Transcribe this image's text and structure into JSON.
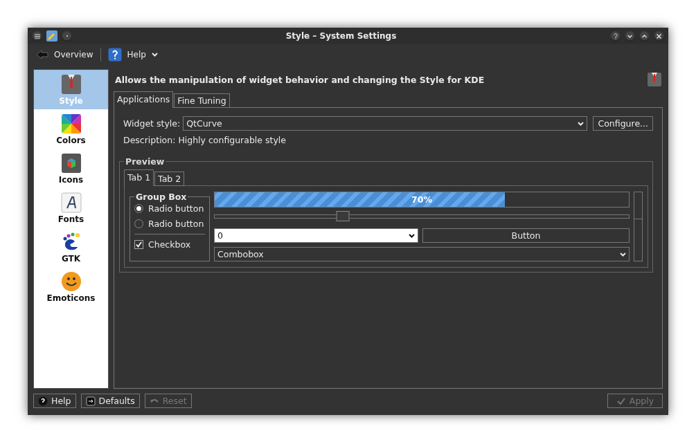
{
  "window": {
    "title": "Style – System Settings"
  },
  "toolbar": [
    {
      "kind": "back",
      "label": "Overview"
    },
    {
      "kind": "help",
      "label": "Help"
    }
  ],
  "sidebar": {
    "items": [
      {
        "kind": "suit",
        "label": "Style",
        "selected": true
      },
      {
        "kind": "colors",
        "label": "Colors",
        "selected": false
      },
      {
        "kind": "cube",
        "label": "Icons",
        "selected": false
      },
      {
        "kind": "font",
        "label": "Fonts",
        "selected": false
      },
      {
        "kind": "foot",
        "label": "GTK",
        "selected": false
      },
      {
        "kind": "smiley",
        "label": "Emoticons",
        "selected": false
      }
    ]
  },
  "header": "Allows the manipulation of widget behavior and changing the Style for KDE",
  "tabs": [
    {
      "label": "Applications",
      "selected": true
    },
    {
      "label": "Fine Tuning",
      "selected": false
    }
  ],
  "widget_style": {
    "label": "Widget style:",
    "value": "QtCurve",
    "button": "Configure..."
  },
  "description": "Description: Highly configurable style",
  "preview": {
    "title": "Preview",
    "tabs": [
      {
        "label": "Tab 1",
        "selected": true
      },
      {
        "label": "Tab 2",
        "selected": false
      }
    ],
    "group_box": {
      "title": "Group Box",
      "radios": [
        {
          "label": "Radio button",
          "selected": true
        },
        {
          "label": "Radio button",
          "selected": false
        }
      ],
      "checkbox": {
        "label": "Checkbox",
        "checked": true
      }
    },
    "progress": {
      "level": 0.7,
      "reading": "70%"
    },
    "slider": {
      "level": 0.31
    },
    "spin": {
      "value": "0"
    },
    "button": "Button",
    "combobox": {
      "value": "Combobox"
    }
  },
  "buttons": [
    {
      "kind": "help",
      "label": "Help",
      "disabled": false
    },
    {
      "kind": "defaults",
      "label": "Defaults",
      "disabled": false
    },
    {
      "kind": "reset",
      "label": "Reset",
      "disabled": true
    },
    {
      "kind": "apply",
      "label": "Apply",
      "disabled": true
    }
  ]
}
